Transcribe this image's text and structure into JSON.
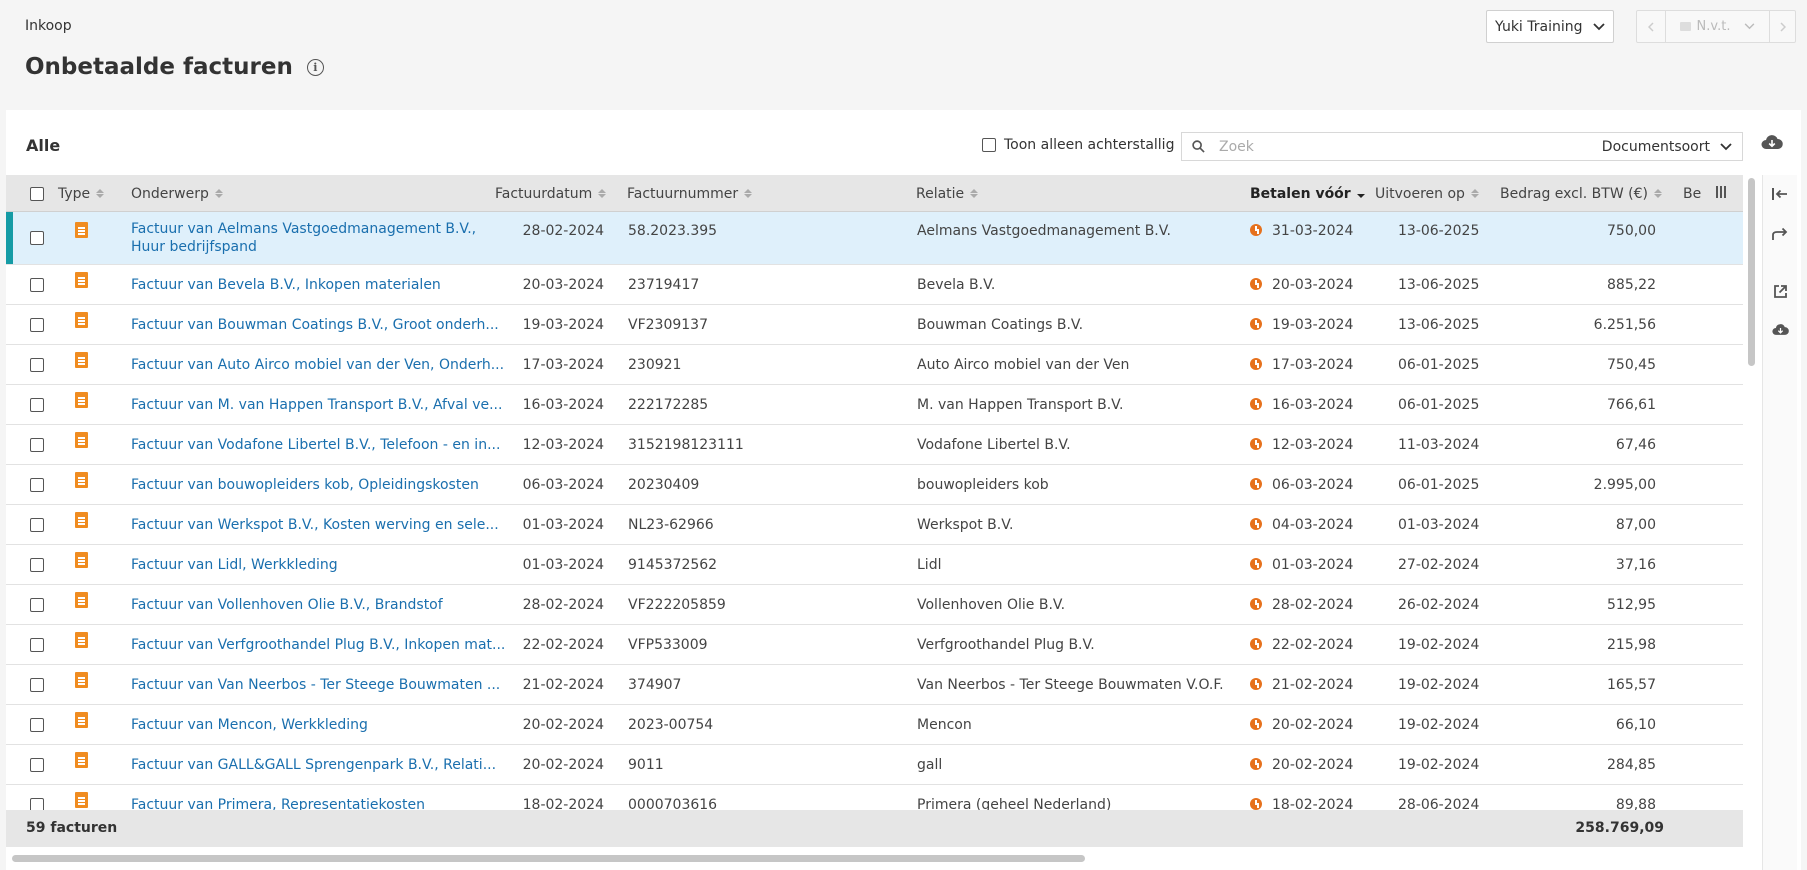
{
  "header": {
    "breadcrumb": "Inkoop",
    "title": "Onbetaalde facturen",
    "administration": "Yuki Training",
    "period": "N.v.t."
  },
  "toolbar": {
    "tab_label": "Alle",
    "overdue_label": "Toon alleen achterstallig",
    "search_placeholder": "Zoek",
    "doc_type_label": "Documentsoort"
  },
  "columns": {
    "type": "Type",
    "subject": "Onderwerp",
    "invoice_date": "Factuurdatum",
    "invoice_number": "Factuurnummer",
    "relation": "Relatie",
    "pay_before": "Betalen vóór",
    "execute_on": "Uitvoeren op",
    "amount": "Bedrag excl. BTW (€)",
    "next": "Be"
  },
  "rows": [
    {
      "subject": "Factuur van Aelmans Vastgoedmanagement B.V.,",
      "subject2": "Huur bedrijfspand",
      "date": "28-02-2024",
      "number": "58.2023.395",
      "relation": "Aelmans Vastgoedmanagement B.V.",
      "pay": "31-03-2024",
      "exec": "13-06-2025",
      "amount": "750,00"
    },
    {
      "subject": "Factuur van Bevela B.V., Inkopen materialen",
      "date": "20-03-2024",
      "number": "23719417",
      "relation": "Bevela B.V.",
      "pay": "20-03-2024",
      "exec": "13-06-2025",
      "amount": "885,22"
    },
    {
      "subject": "Factuur van Bouwman Coatings B.V., Groot onderh...",
      "date": "19-03-2024",
      "number": "VF2309137",
      "relation": "Bouwman Coatings B.V.",
      "pay": "19-03-2024",
      "exec": "13-06-2025",
      "amount": "6.251,56"
    },
    {
      "subject": "Factuur van Auto Airco mobiel van der Ven, Onderh...",
      "date": "17-03-2024",
      "number": "230921",
      "relation": "Auto Airco mobiel van der Ven",
      "pay": "17-03-2024",
      "exec": "06-01-2025",
      "amount": "750,45"
    },
    {
      "subject": "Factuur van M. van Happen Transport B.V., Afval ve...",
      "date": "16-03-2024",
      "number": "222172285",
      "relation": "M. van Happen Transport B.V.",
      "pay": "16-03-2024",
      "exec": "06-01-2025",
      "amount": "766,61"
    },
    {
      "subject": "Factuur van Vodafone Libertel B.V., Telefoon - en in...",
      "date": "12-03-2024",
      "number": "3152198123111",
      "relation": "Vodafone Libertel B.V.",
      "pay": "12-03-2024",
      "exec": "11-03-2024",
      "amount": "67,46"
    },
    {
      "subject": "Factuur van bouwopleiders kob, Opleidingskosten",
      "date": "06-03-2024",
      "number": "20230409",
      "relation": "bouwopleiders kob",
      "pay": "06-03-2024",
      "exec": "06-01-2025",
      "amount": "2.995,00"
    },
    {
      "subject": "Factuur van Werkspot B.V., Kosten werving en sele...",
      "date": "01-03-2024",
      "number": "NL23-62966",
      "relation": "Werkspot B.V.",
      "pay": "04-03-2024",
      "exec": "01-03-2024",
      "amount": "87,00"
    },
    {
      "subject": "Factuur van Lidl, Werkkleding",
      "date": "01-03-2024",
      "number": "9145372562",
      "relation": "Lidl",
      "pay": "01-03-2024",
      "exec": "27-02-2024",
      "amount": "37,16"
    },
    {
      "subject": "Factuur van Vollenhoven Olie B.V., Brandstof",
      "date": "28-02-2024",
      "number": "VF222205859",
      "relation": "Vollenhoven Olie B.V.",
      "pay": "28-02-2024",
      "exec": "26-02-2024",
      "amount": "512,95"
    },
    {
      "subject": "Factuur van Verfgroothandel Plug B.V., Inkopen mat...",
      "date": "22-02-2024",
      "number": "VFP533009",
      "relation": "Verfgroothandel Plug B.V.",
      "pay": "22-02-2024",
      "exec": "19-02-2024",
      "amount": "215,98"
    },
    {
      "subject": "Factuur van Van Neerbos - Ter Steege Bouwmaten ...",
      "date": "21-02-2024",
      "number": "374907",
      "relation": "Van Neerbos - Ter Steege Bouwmaten V.O.F.",
      "pay": "21-02-2024",
      "exec": "19-02-2024",
      "amount": "165,57"
    },
    {
      "subject": "Factuur van Mencon, Werkkleding",
      "date": "20-02-2024",
      "number": "2023-00754",
      "relation": "Mencon",
      "pay": "20-02-2024",
      "exec": "19-02-2024",
      "amount": "66,10"
    },
    {
      "subject": "Factuur van GALL&GALL Sprengenpark B.V., Relati...",
      "date": "20-02-2024",
      "number": "9011",
      "relation": "gall",
      "pay": "20-02-2024",
      "exec": "19-02-2024",
      "amount": "284,85"
    },
    {
      "subject": "Factuur van Primera, Representatiekosten",
      "date": "18-02-2024",
      "number": "0000703616",
      "relation": "Primera (geheel Nederland)",
      "pay": "18-02-2024",
      "exec": "28-06-2024",
      "amount": "89,88"
    }
  ],
  "footer": {
    "count": "59 facturen",
    "total": "258.769,09"
  },
  "colors": {
    "accent": "#159ba5",
    "link": "#1a6fae",
    "doc_icon": "#f08c20",
    "clock": "#e6711d",
    "selected_row": "#dff0fb"
  }
}
